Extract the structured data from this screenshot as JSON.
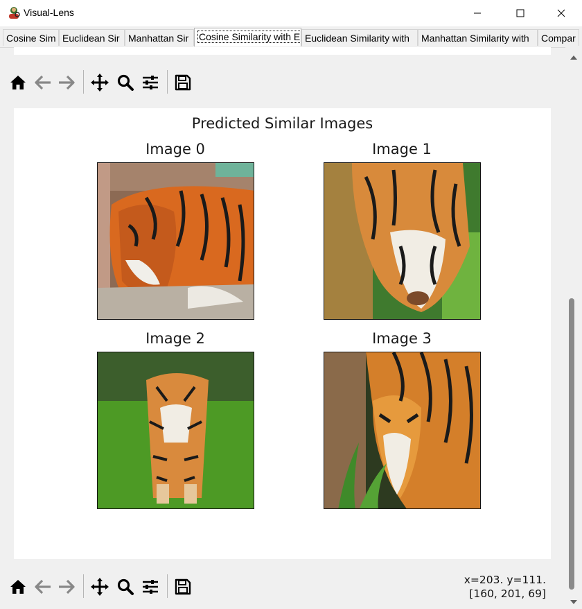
{
  "window": {
    "title": "Visual-Lens",
    "controls": [
      "minimize",
      "maximize",
      "close"
    ]
  },
  "tabs": [
    {
      "label": "Cosine Sim",
      "active": false
    },
    {
      "label": "Euclidean Sir",
      "active": false
    },
    {
      "label": "Manhattan Sir",
      "active": false
    },
    {
      "label": "Cosine Similarity with E",
      "active": true
    },
    {
      "label": "Euclidean Similarity with",
      "active": false
    },
    {
      "label": "Manhattan Similarity with",
      "active": false
    },
    {
      "label": "Compar",
      "active": false
    }
  ],
  "toolbar": {
    "icons": [
      "home-icon",
      "back-arrow-icon",
      "forward-arrow-icon",
      "pan-move-icon",
      "zoom-icon",
      "configure-subplots-icon",
      "save-icon"
    ]
  },
  "figure": {
    "title": "Predicted Similar Images",
    "images": [
      {
        "title": "Image 0",
        "depicts": "tiger-lying-down-icon"
      },
      {
        "title": "Image 1",
        "depicts": "tiger-walking-icon"
      },
      {
        "title": "Image 2",
        "depicts": "tiger-on-grass-icon"
      },
      {
        "title": "Image 3",
        "depicts": "tiger-in-jungle-icon"
      }
    ]
  },
  "status": {
    "line1": "x=203. y=111.",
    "line2": "[160, 201, 69]"
  },
  "colors": {
    "accent": "#000000",
    "panel_bg": "#f0f0f0",
    "figure_bg": "#ffffff",
    "tiger_orange": "#d9691f",
    "grass_green": "#4d9a25"
  }
}
